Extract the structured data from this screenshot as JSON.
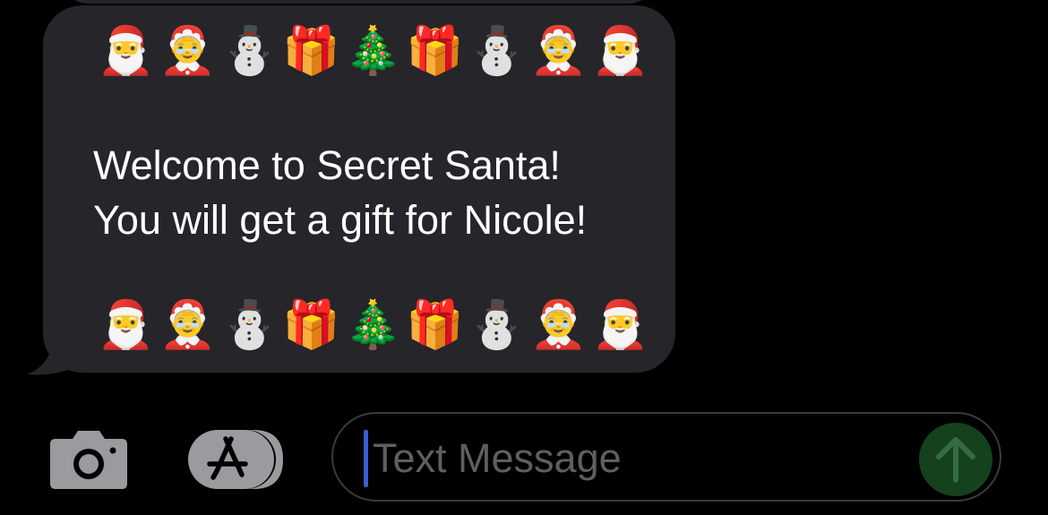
{
  "thread": {
    "message": {
      "emoji_row_top": [
        "🎅",
        "🤶",
        "⛄",
        "🎁",
        "🎄",
        "🎁",
        "⛄",
        "🤶",
        "🎅"
      ],
      "line1": "Welcome to Secret Santa!",
      "line2": "You will get a gift for Nicole!",
      "emoji_row_bottom": [
        "🎅",
        "🤶",
        "⛄",
        "🎁",
        "🎄",
        "🎁",
        "⛄",
        "🤶",
        "🎅"
      ]
    }
  },
  "compose_bar": {
    "camera_icon": "camera-icon",
    "apps_icon": "app-store-icon",
    "input": {
      "placeholder": "Text Message",
      "value": ""
    },
    "send_icon": "arrow-up-icon"
  },
  "colors": {
    "background": "#000000",
    "bubble": "#26252a",
    "text": "#ffffff",
    "placeholder": "#5e5e63",
    "send_button": "#15411e",
    "caret": "#3a5fd0"
  }
}
